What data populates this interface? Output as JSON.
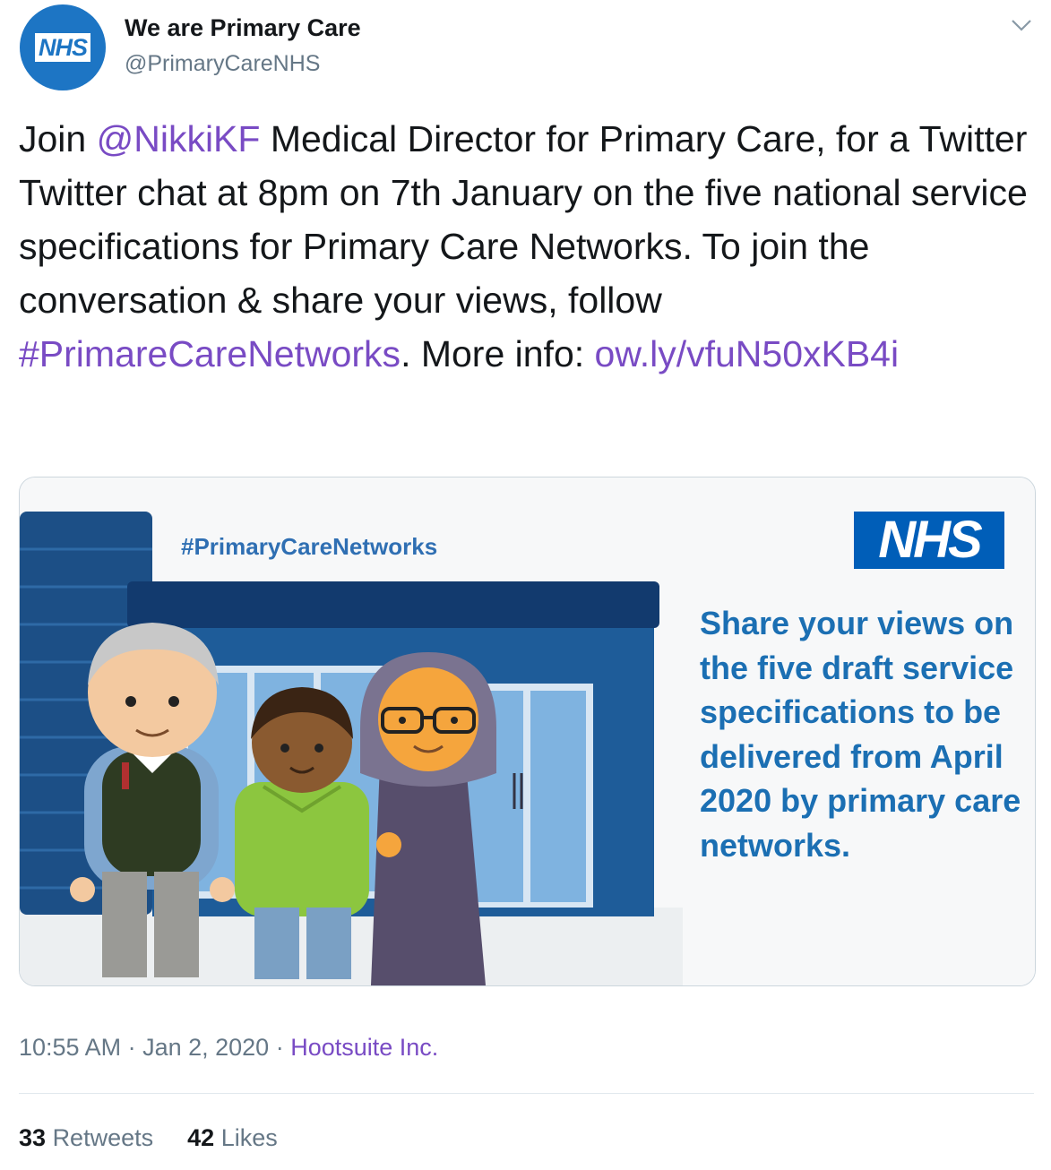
{
  "author": {
    "display_name": "We are Primary Care",
    "handle": "@PrimaryCareNHS",
    "avatar_logo": "NHS",
    "avatar_color": "#1d75c4"
  },
  "tweet": {
    "t1": "Join ",
    "mention": "@NikkiKF",
    "t2": " Medical Director for Primary Care, for a Twitter Twitter chat at 8pm on 7th January on the five national service specifications for Primary Care Networks. To join the conversation & share your views, follow ",
    "hashtag": "#PrimareCareNetworks",
    "t3": ". More info: ",
    "link": "ow.ly/vfuN50xKB4i",
    "link_color": "#794bc4"
  },
  "media": {
    "hashtag": "#PrimaryCareNetworks",
    "nhs_logo": "NHS",
    "nhs_color": "#005eb8",
    "share_text": "Share your views on the five draft service specifications to be delivered from April 2020 by primary care networks."
  },
  "meta": {
    "time": "10:55 AM",
    "sep1": " · ",
    "date": "Jan 2, 2020",
    "sep2": " · ",
    "source": "Hootsuite Inc."
  },
  "stats": {
    "retweets_count": "33",
    "retweets_label": "Retweets",
    "likes_count": "42",
    "likes_label": "Likes"
  },
  "icons": {
    "caret": "chevron-down-icon"
  }
}
